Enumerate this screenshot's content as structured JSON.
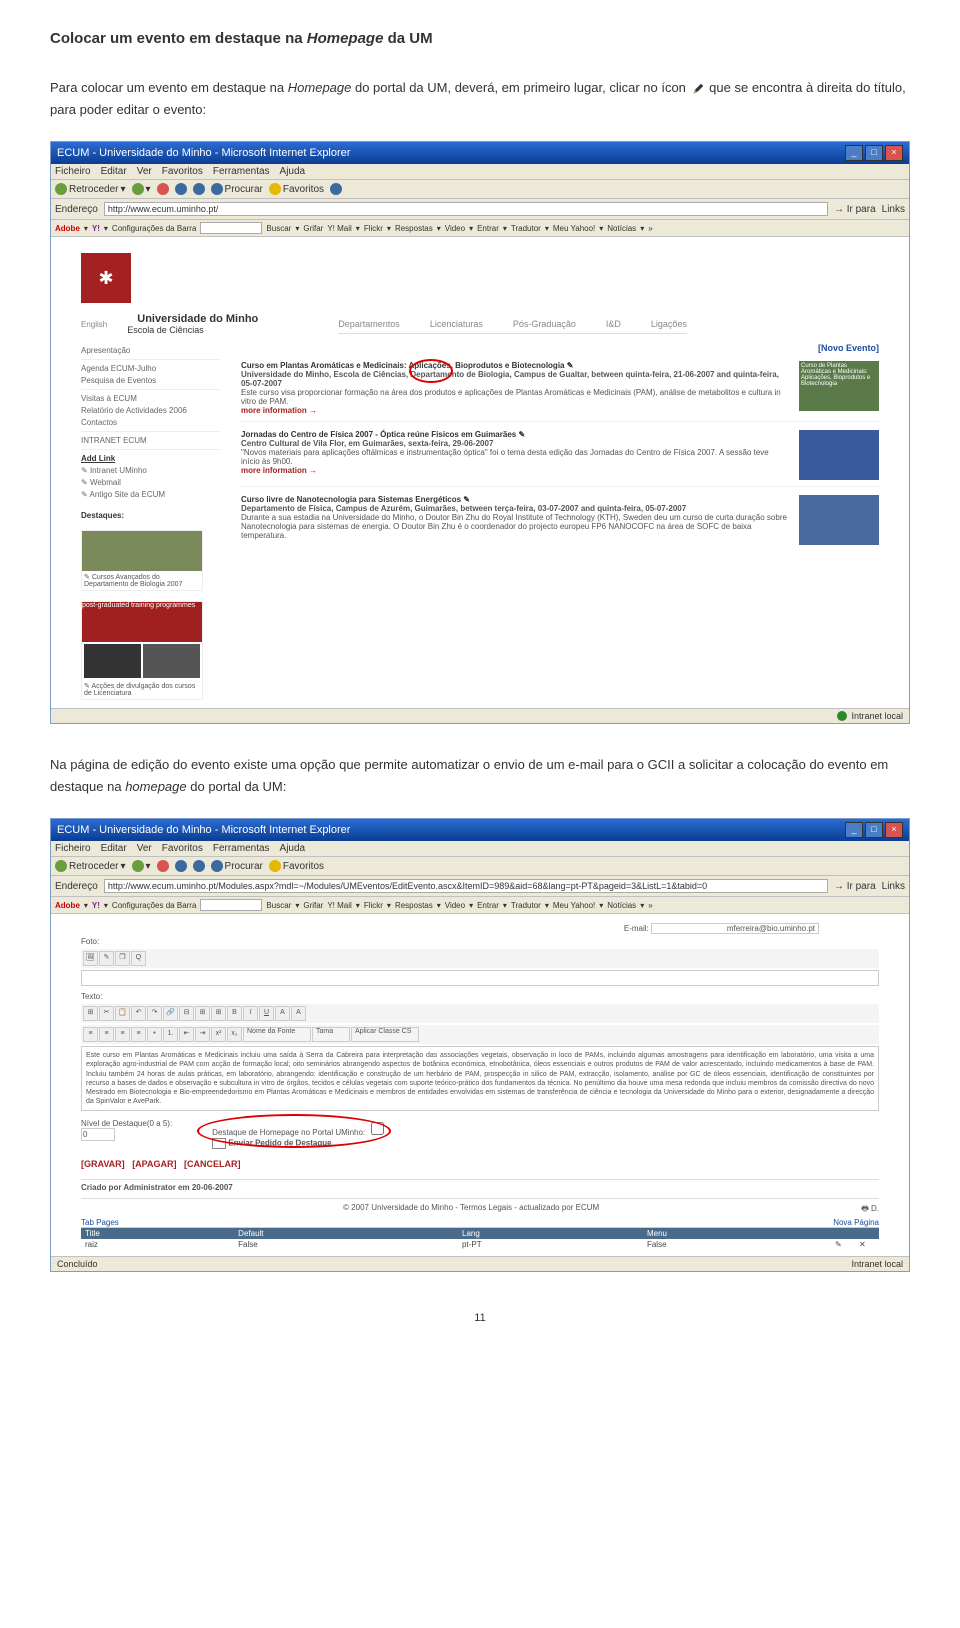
{
  "heading": {
    "prefix": "Colocar um evento em destaque na ",
    "italic": "Homepage",
    "suffix": " da UM"
  },
  "para1": {
    "p1": "Para colocar um evento em destaque na ",
    "p1_italic": "Homepage",
    "p1b": " do portal da UM, deverá, em primeiro lugar, clicar no ícon",
    "p2": " que se encontra à direita do título, para poder editar o evento:"
  },
  "browser1": {
    "title": "ECUM - Universidade do Minho - Microsoft Internet Explorer",
    "menu": [
      "Ficheiro",
      "Editar",
      "Ver",
      "Favoritos",
      "Ferramentas",
      "Ajuda"
    ],
    "toolbar": {
      "back": "Retroceder",
      "search": "Procurar",
      "fav": "Favoritos"
    },
    "url": "http://www.ecum.uminho.pt/",
    "go": "Ir para",
    "links": "Links",
    "adobe": "Adobe",
    "yahoo_items": [
      "Y!",
      "Configurações da Barra",
      "Buscar",
      "Grifar",
      "Y! Mail",
      "Flickr",
      "Respostas",
      "Video",
      "Entrar",
      "Tradutor",
      "Meu Yahoo!",
      "Notícias"
    ],
    "um_name": "Universidade do Minho",
    "um_school": "Escola de Ciências",
    "english": "English",
    "top_nav": [
      "Departamentos",
      "Licenciaturas",
      "Pós-Graduação",
      "I&D",
      "Ligações"
    ],
    "sidebar": {
      "items": [
        "Apresentação",
        "Agenda ECUM-Julho",
        "Pesquisa de Eventos",
        "Visitas à ECUM",
        "Relatório de Actividades 2006",
        "Contactos",
        "INTRANET ECUM"
      ],
      "addlink": "Add Link",
      "links": [
        "Intranet UMinho",
        "Webmail",
        "Antigo Site da ECUM"
      ],
      "destaques": "Destaques:",
      "dest1": "Cursos Avançados do Departamento de Biologia 2007",
      "dest2_box": "post-graduated training programmes",
      "dest3": "Acções de divulgação dos cursos de Licenciatura"
    },
    "novo_evento": "[Novo Evento]",
    "events": [
      {
        "title": "Curso em Plantas Aromáticas e Medicinais: Aplicações, Bioprodutos e Biotecnologia",
        "loc": "Universidade do Minho, Escola de Ciências, Departamento de Biologia, Campus de Gualtar, between quinta-feira, 21-06-2007 and quinta-feira, 05-07-2007",
        "desc": "Este curso visa proporcionar formação na área dos produtos e aplicações de Plantas Aromáticas e Medicinais (PAM), análise de metabolitos e cultura in vitro de PAM.",
        "more": "more information →",
        "thumb_label": "Curso de Plantas Aromáticas e Medicinais: Aplicações, Bioprodutos e Biotecnologia"
      },
      {
        "title": "Jornadas do Centro de Física 2007 - Óptica reúne Físicos em Guimarães",
        "loc": "Centro Cultural de Vila Flor, em Guimarães, sexta-feira, 29-06-2007",
        "desc": "\"Novos materiais para aplicações oftálmicas e instrumentação óptica\" foi o tema desta edição das Jornadas do Centro de Física 2007. A sessão teve início às 9h00.",
        "more": "more information →"
      },
      {
        "title": "Curso livre de Nanotecnologia para Sistemas Energéticos",
        "loc": "Departamento de Física, Campus de Azurém, Guimarães, between terça-feira, 03-07-2007 and quinta-feira, 05-07-2007",
        "desc": "Durante a sua estadia na Universidade do Minho, o Doutor Bin Zhu do Royal Institute of Technology (KTH), Sweden deu um curso de curta duração sobre Nanotecnologia para sistemas de energia. O Doutor Bin Zhu é o coordenador do projecto europeu FP6 NANOCOFC na área de SOFC de baixa temperatura."
      }
    ],
    "status": "Intranet local"
  },
  "para2": {
    "p1": "Na página de edição do evento existe uma opção que permite automatizar o envio de um e-mail para o GCII a solicitar a colocação do evento em destaque na ",
    "p1_italic": "homepage",
    "p1b": " do portal da UM:"
  },
  "browser2": {
    "title": "ECUM - Universidade do Minho - Microsoft Internet Explorer",
    "url": "http://www.ecum.uminho.pt/Modules.aspx?mdl=~/Modules/UMEventos/EditEvento.ascx&ItemID=989&aid=68&lang=pt-PT&pageid=3&ListL=1&tabid=0",
    "email_label": "E-mail:",
    "email_val": "mferreira@bio.uminho.pt",
    "foto_label": "Foto:",
    "texto_label": "Texto:",
    "rt_select1": "Nome da Fonte",
    "rt_select2": "Tama",
    "rt_select3": "Aplicar Classe CS",
    "rich_text": "Este curso em Plantas Aromáticas e Medicinais incluiu uma saída à Serra da Cabreira para interpretação das associações vegetais, observação in loco de PAMs, incluindo algumas amostragens para identificação em laboratório, uma visita a uma exploração agro-industrial de PAM com acção de formação local; oito seminários abrangendo aspectos de botânica económica, etnobotânica, óleos essenciais e outros produtos de PAM de valor acrescentado, incluindo medicamentos à base de PAM. Incluiu também 24 horas de aulas práticas, em laboratório, abrangendo: identificação e construção de um herbário de PAM, prospecção in silico de PAM, extracção, isolamento, análise por GC de óleos essenciais, identificação de constituintes por recurso a bases de dados e observação e subcultura in vitro de órgãos, tecidos e células vegetais com suporte teórico-prático dos fundamentos da técnica. No penúltimo dia houve uma mesa redonda que incluiu membros da comissão directiva do novo Mestrado em Biotecnologia e Bio-empreendedorismo em Plantas Aromáticas e Medicinais e membros de entidades envolvidas em sistemas de transferência de ciência e tecnologia da Universidade do Minho para o exterior, designadamente a direcção da SpinValor e AvePark.",
    "nivel_label": "Nível de Destaque(0 a 5):",
    "nivel_val": "0",
    "hp_label": "Destaque de Homepage no Portal UMinho:",
    "enviar_label": "Enviar Pedido de Destaque",
    "actions": {
      "gravar": "[GRAVAR]",
      "apagar": "[APAGAR]",
      "cancelar": "[CANCELAR]"
    },
    "criado": "Criado por Administrator em 20-06-2007",
    "footer": "© 2007 Universidade do Minho - Termos Legais - actualizado por ECUM",
    "tab_pages": "Tab Pages",
    "nova_pagina": "Nova Página",
    "table": {
      "headers": [
        "Title",
        "Default",
        "Lang",
        "Menu",
        "",
        ""
      ],
      "row": [
        "raiz",
        "False",
        "pt-PT",
        "False",
        "✎",
        "✕"
      ]
    },
    "status": "Concluído",
    "status_r": "Intranet local"
  },
  "page_num": "11"
}
